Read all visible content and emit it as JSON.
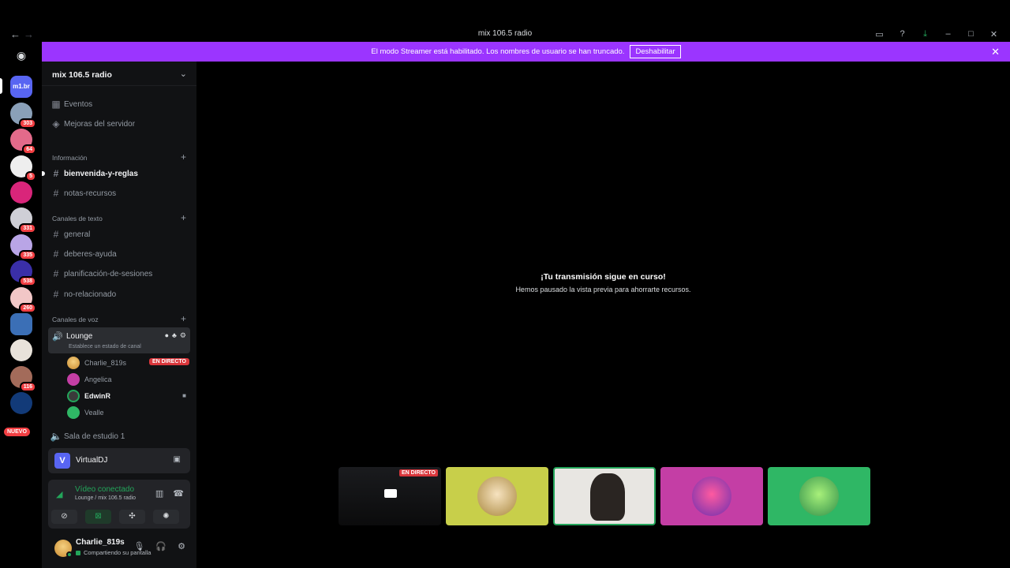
{
  "window": {
    "title": "mix 106.5 radio",
    "back_glyph": "←",
    "forward_glyph": "→"
  },
  "banner": {
    "message": "El modo Streamer está habilitado. Los nombres de usuario se han truncado.",
    "button": "Deshabilitar"
  },
  "rail": {
    "servers": [
      {
        "label": "m1.br",
        "badge": ""
      },
      {
        "label": "",
        "badge": "303"
      },
      {
        "label": "",
        "badge": "64"
      },
      {
        "label": "",
        "badge": "5"
      },
      {
        "label": "",
        "badge": ""
      },
      {
        "label": "",
        "badge": "331"
      },
      {
        "label": "",
        "badge": "335"
      },
      {
        "label": "",
        "badge": "538"
      },
      {
        "label": "",
        "badge": "260"
      },
      {
        "label": "",
        "badge": ""
      },
      {
        "label": "",
        "badge": ""
      },
      {
        "label": "",
        "badge": "116"
      },
      {
        "label": "",
        "badge": ""
      }
    ],
    "new_label": "NUEVO"
  },
  "sidebar": {
    "server_name": "mix 106.5 radio",
    "top_items": [
      {
        "label": "Eventos",
        "icon": "calendar-icon"
      },
      {
        "label": "Mejoras del servidor",
        "icon": "boost-icon"
      }
    ],
    "categories": {
      "info": "Información",
      "text": "Canales de texto",
      "voice": "Canales de voz"
    },
    "info_channels": [
      "bienvenida-y-reglas",
      "notas-recursos"
    ],
    "text_channels": [
      "general",
      "deberes-ayuda",
      "planificación-de-sesiones",
      "no-relacionado"
    ],
    "voice_channel": {
      "name": "Lounge",
      "status": "Establece un estado de canal"
    },
    "voice_users": [
      {
        "name": "Charlie_819s",
        "live": "EN DIRECTO"
      },
      {
        "name": "Angelica"
      },
      {
        "name": "EdwinR"
      },
      {
        "name": "Vealle"
      }
    ],
    "other_voice": "Sala de estudio 1"
  },
  "app_panel": {
    "icon_letter": "V",
    "name": "VirtualDJ"
  },
  "voice_panel": {
    "status": "Vídeo conectado",
    "sub": "Lounge / mix 106.5 radio"
  },
  "user_panel": {
    "name": "Charlie_819s",
    "status": "Compartiendo su pantalla"
  },
  "main": {
    "title": "¡Tu transmisión sigue en curso!",
    "subtitle": "Hemos pausado la vista previa para ahorrarte recursos.",
    "live_label": "EN DIRECTO"
  },
  "colors": {
    "banner": "#9b35ff",
    "live": "#da373c",
    "connected": "#23a55a",
    "tile_yellow": "#c8cf4a",
    "tile_pink": "#c43ea5",
    "tile_green": "#2fb765"
  }
}
